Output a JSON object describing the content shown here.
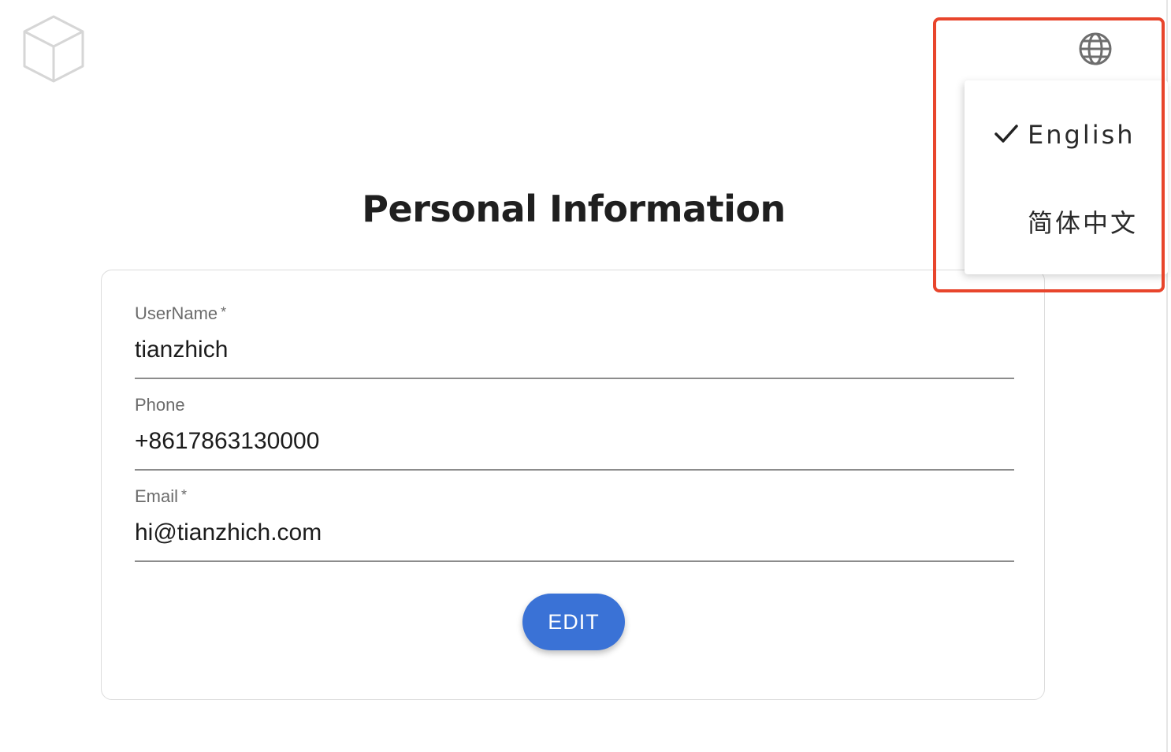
{
  "header": {
    "logo": "cube-logo-icon",
    "language_icon": "globe-icon"
  },
  "page": {
    "title": "Personal Information"
  },
  "form": {
    "username": {
      "label": "UserName",
      "required_mark": "*",
      "value": "tianzhich"
    },
    "phone": {
      "label": "Phone",
      "value": "+8617863130000"
    },
    "email": {
      "label": "Email",
      "required_mark": "*",
      "value": "hi@tianzhich.com"
    },
    "edit_label": "EDIT"
  },
  "language_menu": {
    "items": [
      {
        "label": "English",
        "selected": true,
        "icon": "check-icon"
      },
      {
        "label": "简体中文",
        "selected": false
      }
    ]
  },
  "colors": {
    "primary_button": "#3a72d6",
    "highlight": "#e8452c"
  }
}
